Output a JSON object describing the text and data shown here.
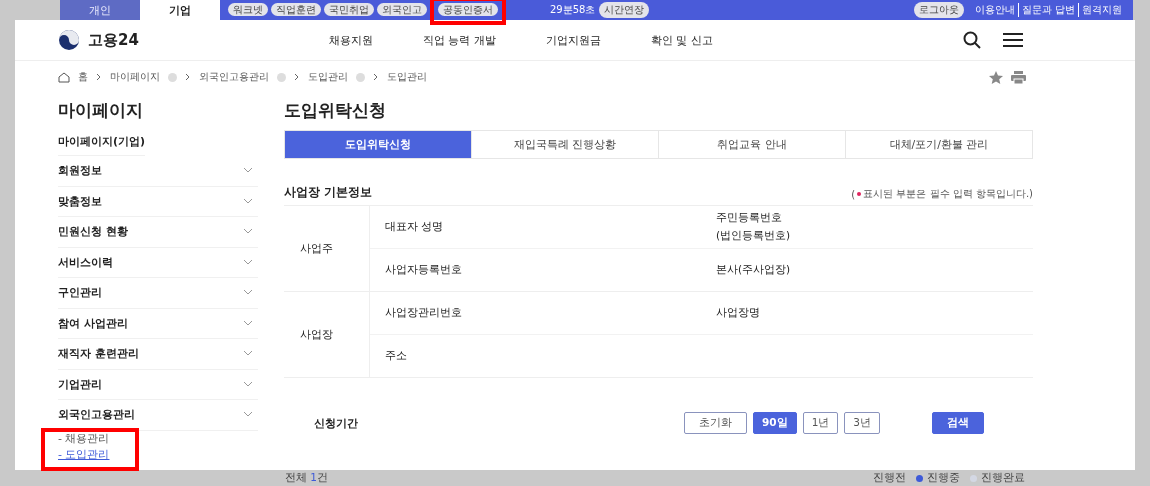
{
  "top_bar": {
    "user_tabs": [
      {
        "label": "개인",
        "selected": false
      },
      {
        "label": "기업",
        "selected": true
      }
    ],
    "quick_links": [
      "워크넷",
      "직업훈련",
      "국민취업",
      "외국인고",
      "공동인증서"
    ],
    "timer": "29분58초",
    "extend_button": "시간연장",
    "logout_button": "로그아웃",
    "util_links": [
      "이용안내",
      "질문과 답변",
      "원격지원"
    ]
  },
  "header": {
    "logo": "고용24",
    "nav": [
      "채용지원",
      "직업 능력 개발",
      "기업지원금",
      "확인 및 신고"
    ]
  },
  "breadcrumb": [
    {
      "label": "홈",
      "dropdown": false
    },
    {
      "label": "마이페이지",
      "dropdown": true
    },
    {
      "label": "외국인고용관리",
      "dropdown": true
    },
    {
      "label": "도입관리",
      "dropdown": true
    },
    {
      "label": "도입관리",
      "dropdown": false
    }
  ],
  "sidebar": {
    "title": "마이페이지",
    "home": "마이페이지(기업)",
    "items": [
      {
        "label": "회원정보"
      },
      {
        "label": "맞춤정보"
      },
      {
        "label": "민원신청 현황"
      },
      {
        "label": "서비스이력"
      },
      {
        "label": "구인관리"
      },
      {
        "label": "참여 사업관리"
      },
      {
        "label": "재직자 훈련관리"
      },
      {
        "label": "기업관리"
      },
      {
        "label": "외국인고용관리",
        "children": [
          {
            "label": "- 채용관리",
            "selected": false
          },
          {
            "label": "- 도입관리",
            "selected": true
          }
        ]
      }
    ]
  },
  "page": {
    "title": "도입위탁신청",
    "tabs": [
      {
        "label": "도입위탁신청",
        "selected": true
      },
      {
        "label": "재입국특례 진행상황",
        "selected": false
      },
      {
        "label": "취업교육 안내",
        "selected": false
      },
      {
        "label": "대체/포기/환불 관리",
        "selected": false
      }
    ],
    "section_title": "사업장 기본정보",
    "required_note": [
      "(",
      "표시된 부분은 필수 입력 항목입니다.)"
    ],
    "table": [
      {
        "header": "사업주",
        "rows": [
          [
            "대표자 성명",
            "주민등록번호\n(법인등록번호)"
          ],
          [
            "사업자등록번호",
            "본사(주사업장)"
          ]
        ]
      },
      {
        "header": "사업장",
        "rows": [
          [
            "사업장관리번호",
            "사업장명"
          ],
          [
            "주소"
          ]
        ]
      }
    ],
    "period": {
      "label": "신청기간",
      "reset_button": "초기화",
      "ranges": [
        {
          "label": "90일",
          "selected": true
        },
        {
          "label": "1년",
          "selected": false
        },
        {
          "label": "3년",
          "selected": false
        }
      ],
      "search_button": "검색"
    }
  },
  "footer": {
    "total_label": "전체",
    "total_count": "1",
    "total_unit": "건",
    "legend": [
      {
        "label": "진행전"
      },
      {
        "label": "진행중",
        "color": "#3e5ad8"
      },
      {
        "label": "진행완료",
        "color": "#d4d8e4"
      }
    ]
  }
}
